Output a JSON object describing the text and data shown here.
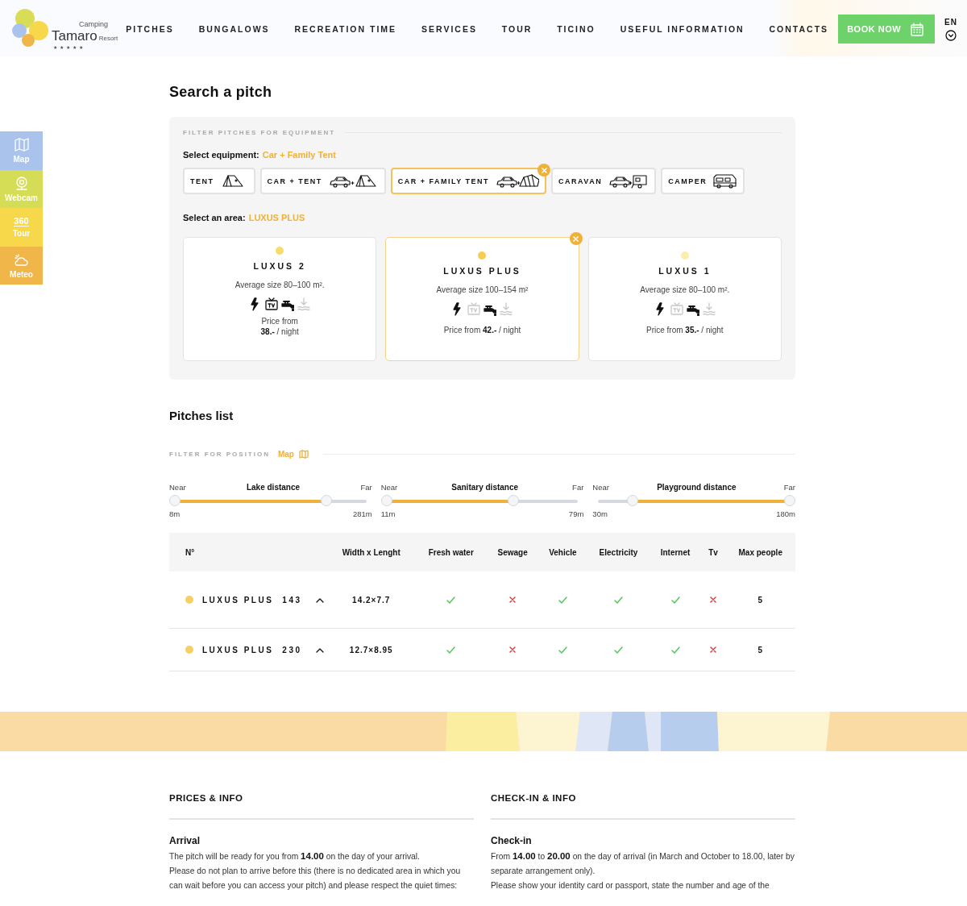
{
  "header": {
    "logo": {
      "top": "Camping",
      "name": "Tamaro",
      "suffix": "Resort",
      "stars": "★★★★★"
    },
    "nav": [
      "PITCHES",
      "BUNGALOWS",
      "RECREATION TIME",
      "SERVICES",
      "TOUR",
      "TICINO",
      "USEFUL INFORMATION",
      "CONTACTS"
    ],
    "book_button": "BOOK NOW",
    "language": "EN"
  },
  "side_tabs": [
    {
      "label": "Map",
      "kind": "map",
      "color": "#a9c3ec"
    },
    {
      "label": "Webcam",
      "kind": "webcam",
      "color": "#d5dc55"
    },
    {
      "label": "Tour",
      "kind": "tour",
      "icon_text": "360",
      "color": "#f6d84a"
    },
    {
      "label": "Meteo",
      "kind": "meteo",
      "color": "#f0b649"
    }
  ],
  "title": "Search a pitch",
  "equipment_filter": {
    "heading": "FILTER PITCHES FOR EQUIPMENT",
    "label": "Select equipment:",
    "value": "Car + Family Tent",
    "options": [
      {
        "label": "TENT",
        "kind": "tent",
        "selected": false
      },
      {
        "label": "CAR + TENT",
        "kind": "car_tent",
        "selected": false
      },
      {
        "label": "CAR + FAMILY TENT",
        "kind": "car_family_tent",
        "selected": true
      },
      {
        "label": "CARAVAN",
        "kind": "caravan",
        "selected": false
      },
      {
        "label": "CAMPER",
        "kind": "camper",
        "selected": false
      }
    ]
  },
  "area_filter": {
    "label": "Select an area:",
    "value": "LUXUS PLUS",
    "areas": [
      {
        "name": "LUXUS 2",
        "color": "#f6dc6a",
        "size": "Average size 80–100 m².",
        "price": "Price from **38.-** / night",
        "selected": false,
        "amenities": [
          {
            "kind": "electricity",
            "active": true
          },
          {
            "kind": "tv",
            "active": true
          },
          {
            "kind": "water",
            "active": true
          },
          {
            "kind": "lake",
            "active": false
          }
        ]
      },
      {
        "name": "LUXUS PLUS",
        "color": "#f5cd55",
        "size": "Average size 100–154 m²",
        "price": "Price from **42.-** / night",
        "selected": true,
        "amenities": [
          {
            "kind": "electricity",
            "active": true
          },
          {
            "kind": "tv",
            "active": false
          },
          {
            "kind": "water",
            "active": true
          },
          {
            "kind": "lake",
            "active": false
          }
        ]
      },
      {
        "name": "LUXUS 1",
        "color": "#fbeeaa",
        "size": "Average size 80–100 m².",
        "price": "Price from **35.-** / night",
        "selected": false,
        "amenities": [
          {
            "kind": "electricity",
            "active": true
          },
          {
            "kind": "tv",
            "active": false
          },
          {
            "kind": "water",
            "active": true
          },
          {
            "kind": "lake",
            "active": false
          }
        ]
      }
    ]
  },
  "pitches": {
    "title": "Pitches list",
    "position_filter": "FILTER FOR POSITION",
    "map_link": "Map",
    "sliders": [
      {
        "name": "Lake distance",
        "near": "Near",
        "far": "Far",
        "min": "8m",
        "max": "281m",
        "handles": [
          {
            "level": 0
          },
          {
            "level": 0.79
          }
        ]
      },
      {
        "name": "Sanitary distance",
        "near": "Near",
        "far": "Far",
        "min": "11m",
        "max": "79m",
        "handles": [
          {
            "level": 0
          },
          {
            "level": 0.66
          }
        ]
      },
      {
        "name": "Playground distance",
        "near": "Near",
        "far": "Far",
        "min": "30m",
        "max": "180m",
        "handles": [
          {
            "level": 0.18
          },
          {
            "level": 1
          }
        ]
      }
    ],
    "columns": [
      "N°",
      "Width x Lenght",
      "Fresh water",
      "Sewage",
      "Vehicle",
      "Electricity",
      "Internet",
      "Tv",
      "Max people"
    ],
    "rows": [
      {
        "color": "#f6d063",
        "area": "LUXUS PLUS",
        "number": "143",
        "expanded": true,
        "size": "14.2×7.7",
        "features": [
          true,
          false,
          true,
          true,
          true,
          false
        ],
        "max_people": "5"
      },
      {
        "color": "#f6d063",
        "area": "LUXUS PLUS",
        "number": "230",
        "expanded": true,
        "size": "12.7×8.95",
        "features": [
          true,
          false,
          true,
          true,
          true,
          false
        ],
        "max_people": "5"
      }
    ]
  },
  "info": [
    {
      "heading": "PRICES & INFO",
      "subheading": "Arrival",
      "paragraphs": [
        "The pitch will be ready for you from **14.00** on the day of your arrival.",
        "Please do not plan to arrive before this (there is no dedicated area in which you can wait before you can access your pitch) and please respect the quiet times:"
      ]
    },
    {
      "heading": "CHECK-IN & INFO",
      "subheading": "Check-in",
      "paragraphs": [
        "From **14.00** to **20.00** on the day of arrival (in March and October to 18.00, later by separate arrangement only).",
        "Please show your identity card or passport, state the number and age of the"
      ]
    }
  ]
}
